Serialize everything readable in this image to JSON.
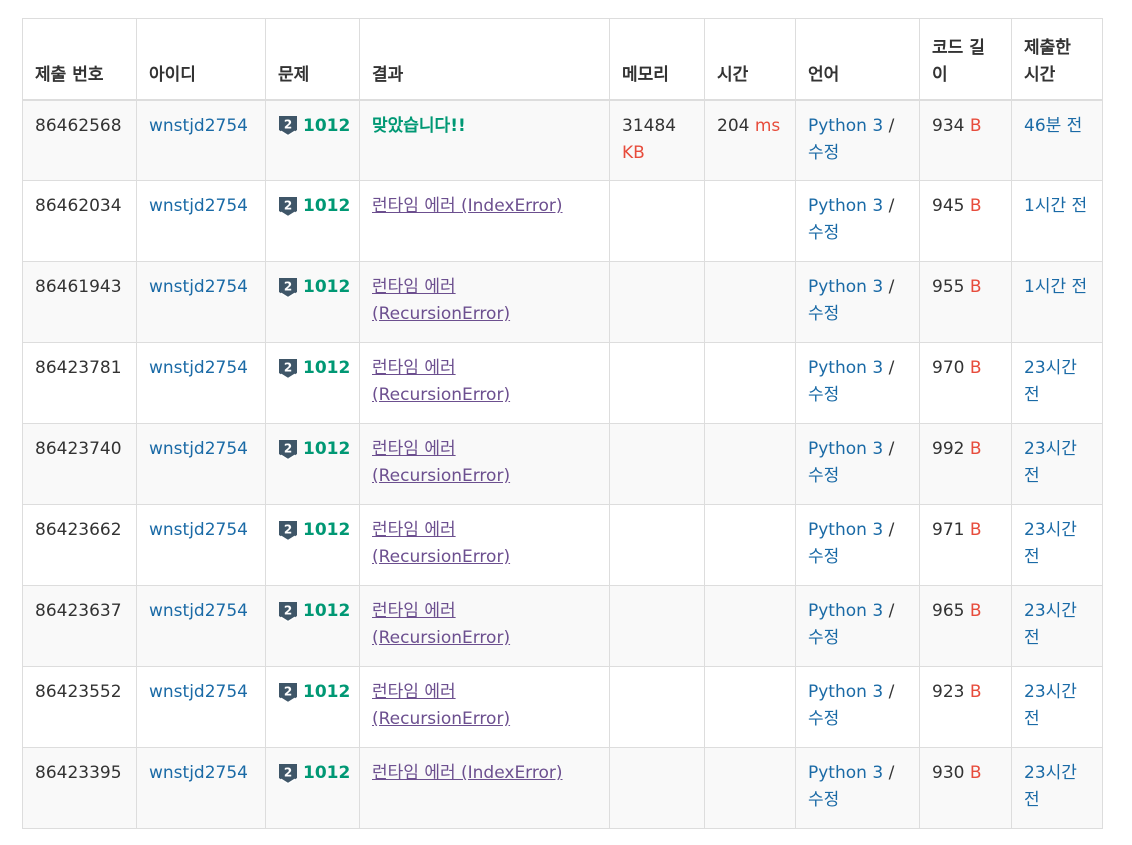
{
  "headers": {
    "id": "제출 번호",
    "user": "아이디",
    "problem": "문제",
    "result": "결과",
    "memory": "메모리",
    "time": "시간",
    "lang": "언어",
    "code": "코드 길이",
    "submitted": "제출한 시간"
  },
  "rows": [
    {
      "id": "86462568",
      "user": "wnstjd2754",
      "tier": "2",
      "problem": "1012",
      "result": "맞았습니다!!",
      "result_type": "ac",
      "memory": "31484",
      "memory_unit": "KB",
      "time": "204",
      "time_unit": "ms",
      "lang": "Python 3",
      "edit": "수정",
      "code": "934",
      "code_unit": "B",
      "submitted": "46분 전"
    },
    {
      "id": "86462034",
      "user": "wnstjd2754",
      "tier": "2",
      "problem": "1012",
      "result": "런타임 에러 (IndexError)",
      "result_type": "re",
      "memory": "",
      "memory_unit": "",
      "time": "",
      "time_unit": "",
      "lang": "Python 3",
      "edit": "수정",
      "code": "945",
      "code_unit": "B",
      "submitted": "1시간 전"
    },
    {
      "id": "86461943",
      "user": "wnstjd2754",
      "tier": "2",
      "problem": "1012",
      "result": "런타임 에러 (RecursionError)",
      "result_type": "re",
      "memory": "",
      "memory_unit": "",
      "time": "",
      "time_unit": "",
      "lang": "Python 3",
      "edit": "수정",
      "code": "955",
      "code_unit": "B",
      "submitted": "1시간 전"
    },
    {
      "id": "86423781",
      "user": "wnstjd2754",
      "tier": "2",
      "problem": "1012",
      "result": "런타임 에러 (RecursionError)",
      "result_type": "re",
      "memory": "",
      "memory_unit": "",
      "time": "",
      "time_unit": "",
      "lang": "Python 3",
      "edit": "수정",
      "code": "970",
      "code_unit": "B",
      "submitted": "23시간 전"
    },
    {
      "id": "86423740",
      "user": "wnstjd2754",
      "tier": "2",
      "problem": "1012",
      "result": "런타임 에러 (RecursionError)",
      "result_type": "re",
      "memory": "",
      "memory_unit": "",
      "time": "",
      "time_unit": "",
      "lang": "Python 3",
      "edit": "수정",
      "code": "992",
      "code_unit": "B",
      "submitted": "23시간 전"
    },
    {
      "id": "86423662",
      "user": "wnstjd2754",
      "tier": "2",
      "problem": "1012",
      "result": "런타임 에러 (RecursionError)",
      "result_type": "re",
      "memory": "",
      "memory_unit": "",
      "time": "",
      "time_unit": "",
      "lang": "Python 3",
      "edit": "수정",
      "code": "971",
      "code_unit": "B",
      "submitted": "23시간 전"
    },
    {
      "id": "86423637",
      "user": "wnstjd2754",
      "tier": "2",
      "problem": "1012",
      "result": "런타임 에러 (RecursionError)",
      "result_type": "re",
      "memory": "",
      "memory_unit": "",
      "time": "",
      "time_unit": "",
      "lang": "Python 3",
      "edit": "수정",
      "code": "965",
      "code_unit": "B",
      "submitted": "23시간 전"
    },
    {
      "id": "86423552",
      "user": "wnstjd2754",
      "tier": "2",
      "problem": "1012",
      "result": "런타임 에러 (RecursionError)",
      "result_type": "re",
      "memory": "",
      "memory_unit": "",
      "time": "",
      "time_unit": "",
      "lang": "Python 3",
      "edit": "수정",
      "code": "923",
      "code_unit": "B",
      "submitted": "23시간 전"
    },
    {
      "id": "86423395",
      "user": "wnstjd2754",
      "tier": "2",
      "problem": "1012",
      "result": "런타임 에러 (IndexError)",
      "result_type": "re",
      "memory": "",
      "memory_unit": "",
      "time": "",
      "time_unit": "",
      "lang": "Python 3",
      "edit": "수정",
      "code": "930",
      "code_unit": "B",
      "submitted": "23시간 전"
    }
  ],
  "colors": {
    "link": "#1a6aa6",
    "accepted": "#009874",
    "runtime_error": "#6c4f8f",
    "unit": "#e74c3c",
    "tier_badge": "#3f5668"
  },
  "icons": {
    "tier": "silver-tier-icon"
  }
}
